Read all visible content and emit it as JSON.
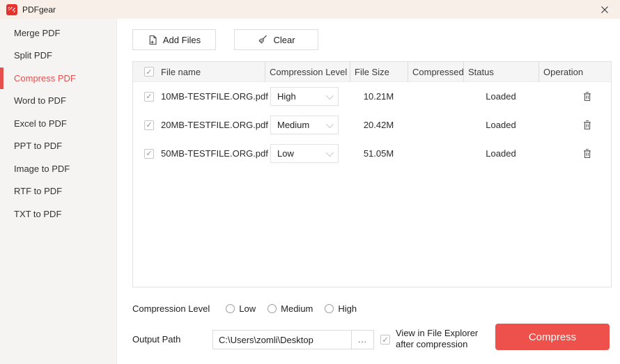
{
  "window": {
    "title": "PDFgear"
  },
  "sidebar": {
    "items": [
      {
        "label": "Merge PDF",
        "active": false
      },
      {
        "label": "Split PDF",
        "active": false
      },
      {
        "label": "Compress PDF",
        "active": true
      },
      {
        "label": "Word to PDF",
        "active": false
      },
      {
        "label": "Excel to PDF",
        "active": false
      },
      {
        "label": "PPT to PDF",
        "active": false
      },
      {
        "label": "Image to PDF",
        "active": false
      },
      {
        "label": "RTF to PDF",
        "active": false
      },
      {
        "label": "TXT to PDF",
        "active": false
      }
    ]
  },
  "toolbar": {
    "add_files": "Add Files",
    "clear": "Clear"
  },
  "table": {
    "select_all_checked": true,
    "columns": {
      "file_name": "File name",
      "compression_level": "Compression Level",
      "file_size": "File Size",
      "compressed": "Compressed",
      "status": "Status",
      "operation": "Operation"
    },
    "rows": [
      {
        "checked": true,
        "file_name": "10MB-TESTFILE.ORG.pdf",
        "compression_level": "High",
        "file_size": "10.21M",
        "compressed": "",
        "status": "Loaded"
      },
      {
        "checked": true,
        "file_name": "20MB-TESTFILE.ORG.pdf",
        "compression_level": "Medium",
        "file_size": "20.42M",
        "compressed": "",
        "status": "Loaded"
      },
      {
        "checked": true,
        "file_name": "50MB-TESTFILE.ORG.pdf",
        "compression_level": "Low",
        "file_size": "51.05M",
        "compressed": "",
        "status": "Loaded"
      }
    ]
  },
  "footer": {
    "compression_level_label": "Compression Level",
    "radio_options": {
      "low": "Low",
      "medium": "Medium",
      "high": "High"
    },
    "radios_checked": {
      "low": false,
      "medium": false,
      "high": false
    },
    "output_path_label": "Output Path",
    "output_path_value": "C:\\Users\\zomli\\Desktop",
    "browse_label": "...",
    "view_checkbox_checked": true,
    "view_label_line1": "View in File Explorer",
    "view_label_line2": "after compression",
    "compress_label": "Compress"
  },
  "colors": {
    "accent_red": "#ee504c",
    "sidebar_active": "#e5504e",
    "titlebar_bg": "#f8efe9",
    "logo_red": "#e5322d"
  }
}
